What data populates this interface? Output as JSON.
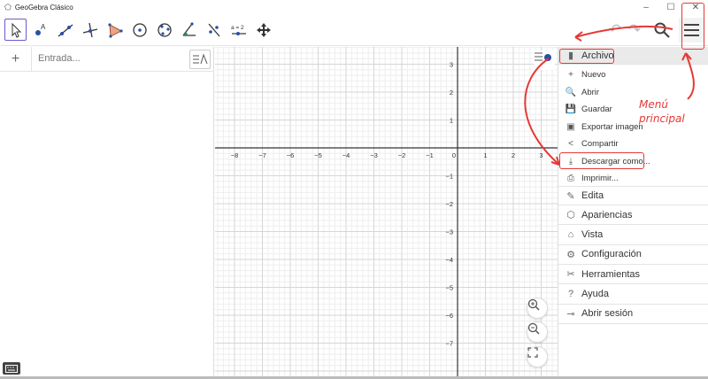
{
  "window": {
    "title": "GeoGebra Clásico",
    "min": "–",
    "max": "☐",
    "close": "✕"
  },
  "toolbar": {
    "tools": [
      {
        "name": "move-tool-icon"
      },
      {
        "name": "point-tool-icon"
      },
      {
        "name": "line-tool-icon"
      },
      {
        "name": "perpendicular-tool-icon"
      },
      {
        "name": "polygon-tool-icon"
      },
      {
        "name": "circle-center-tool-icon"
      },
      {
        "name": "circle-3points-tool-icon"
      },
      {
        "name": "angle-tool-icon"
      },
      {
        "name": "reflect-tool-icon"
      },
      {
        "name": "slider-tool-icon",
        "label": "a = 2"
      },
      {
        "name": "move-view-tool-icon"
      }
    ],
    "undo": "↶",
    "redo": "↷"
  },
  "algebra": {
    "plus": "+",
    "input_placeholder": "Entrada...",
    "style_glyph": "☰⁄"
  },
  "graphics": {
    "style_glyph": "☰",
    "x_ticks": [
      "−8",
      "−7",
      "−6",
      "−5",
      "−4",
      "−3",
      "−2",
      "−1",
      "0",
      "1",
      "2",
      "3"
    ],
    "y_ticks_pos": [
      "3",
      "2",
      "1"
    ],
    "y_ticks_neg": [
      "−1",
      "−2",
      "−3",
      "−4",
      "−5",
      "−6",
      "−7"
    ],
    "zoom_in": "⊕",
    "zoom_out": "⊖",
    "fullscreen": "⛶"
  },
  "menu": {
    "archivo": "Archivo",
    "file_items": [
      {
        "icon": "+",
        "label": "Nuevo",
        "name": "nuevo"
      },
      {
        "icon": "🔍",
        "label": "Abrir",
        "name": "abrir"
      },
      {
        "icon": "💾",
        "label": "Guardar",
        "name": "guardar"
      },
      {
        "icon": "▣",
        "label": "Exportar imagen",
        "name": "exportar-imagen"
      },
      {
        "icon": "<",
        "label": "Compartir",
        "name": "compartir"
      },
      {
        "icon": "⤓",
        "label": "Descargar como...",
        "name": "descargar-como"
      },
      {
        "icon": "⎙",
        "label": "Imprimir...",
        "name": "imprimir"
      }
    ],
    "main_items": [
      {
        "icon": "✎",
        "label": "Edita",
        "name": "edita"
      },
      {
        "icon": "⬡",
        "label": "Apariencias",
        "name": "apariencias"
      },
      {
        "icon": "⌂",
        "label": "Vista",
        "name": "vista"
      },
      {
        "icon": "⚙",
        "label": "Configuración",
        "name": "configuracion"
      },
      {
        "icon": "✂",
        "label": "Herramientas",
        "name": "herramientas"
      },
      {
        "icon": "?",
        "label": "Ayuda",
        "name": "ayuda"
      },
      {
        "icon": "⊸",
        "label": "Abrir sesión",
        "name": "abrir-sesion"
      }
    ]
  },
  "annotation": {
    "line1": "Menú",
    "line2": "principal",
    "color": "#e53935"
  }
}
